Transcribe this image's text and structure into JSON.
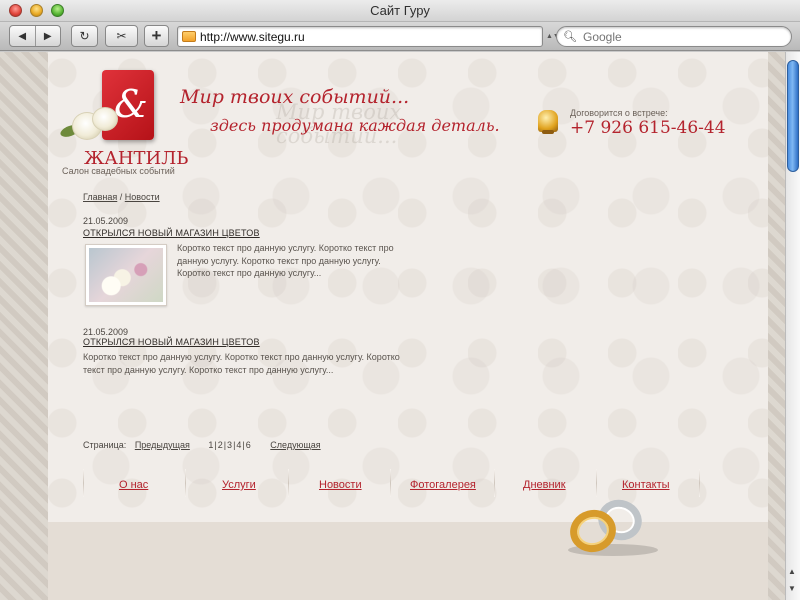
{
  "window": {
    "title": "Сайт Гуру"
  },
  "toolbar": {
    "back_icon": "◀",
    "forward_icon": "▶",
    "reload_icon": "↻",
    "snap_icon": "✂",
    "add_icon": "+",
    "url": "http://www.sitegu.ru",
    "search_placeholder": "Google"
  },
  "site": {
    "brand_name": "ЖАНТИЛЬ",
    "brand_subtitle": "Салон свадебных событий",
    "slogan_line1": "Мир твоих событий...",
    "slogan_line2": "здесь продумана каждая деталь.",
    "contact_label": "Договорится о встрече:",
    "contact_phone_prefix": "+7 926 ",
    "contact_phone_number": "615-46-44"
  },
  "breadcrumb": {
    "home": "Главная",
    "separator": " / ",
    "current": "Новости"
  },
  "news": [
    {
      "date": "21.05.2009",
      "title": "Открылся новый магазин цветов",
      "text_lines": [
        "Коротко текст про данную услугу.  Коротко текст про",
        "данную услугу. Коротко текст про данную услугу.",
        "Коротко текст про данную услугу..."
      ]
    },
    {
      "date": "21.05.2009",
      "title": "Открылся новый магазин цветов",
      "text_lines": [
        "Коротко текст про данную услугу.  Коротко текст про данную услугу. Коротко",
        "текст про данную услугу.   Коротко текст про данную услугу..."
      ]
    }
  ],
  "pagination": {
    "label": "Страница:",
    "prev": "Предыдущая",
    "pages": "1|2|3|4|6",
    "next": "Следующая"
  },
  "nav": {
    "items": [
      "О нас",
      "Услуги",
      "Новости",
      "Фотогалерея",
      "Дневник",
      "Контакты"
    ]
  },
  "colors": {
    "accent": "#b4232d",
    "text": "#4a4540",
    "page_bg": "#f1ede9"
  }
}
